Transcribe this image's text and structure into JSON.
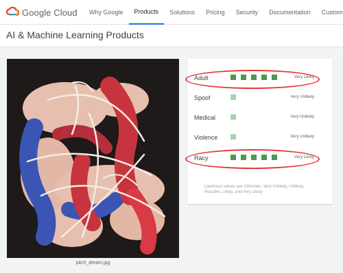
{
  "brand": {
    "name": "Google Cloud"
  },
  "nav": [
    {
      "label": "Why Google"
    },
    {
      "label": "Products"
    },
    {
      "label": "Solutions"
    },
    {
      "label": "Pricing"
    },
    {
      "label": "Security"
    },
    {
      "label": "Documentation"
    },
    {
      "label": "Customers"
    }
  ],
  "page": {
    "title": "AI & Machine Learning Products"
  },
  "image": {
    "caption": "pitch_dream.jpg"
  },
  "safe_search": {
    "rows": [
      {
        "label": "Adult",
        "level": 5,
        "value": "Very Likely",
        "highlighted": true
      },
      {
        "label": "Spoof",
        "level": 1,
        "value": "Very Unlikely",
        "highlighted": false
      },
      {
        "label": "Medical",
        "level": 1,
        "value": "Very Unlikely",
        "highlighted": false
      },
      {
        "label": "Violence",
        "level": 1,
        "value": "Very Unlikely",
        "highlighted": false
      },
      {
        "label": "Racy",
        "level": 5,
        "value": "Very Likely",
        "highlighted": true
      }
    ],
    "note": "Likeliness values are Unknown, Very Unlikely, Unlikely, Possible, Likely, and Very Likely"
  },
  "colors": {
    "accent": "#1a73e8",
    "bar_on": "#4a9a4f",
    "bar_faint": "#a8d3a9",
    "highlight": "#e53935"
  }
}
